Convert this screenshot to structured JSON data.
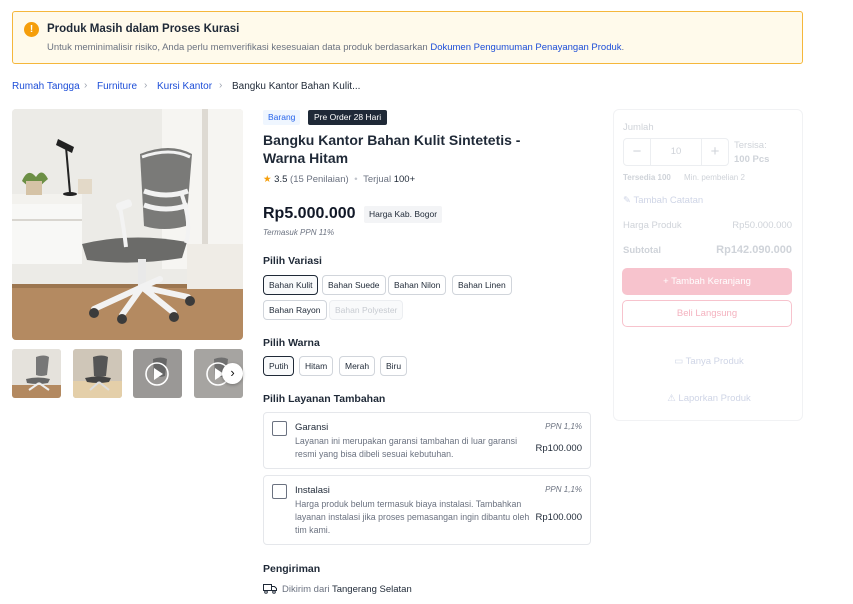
{
  "alert": {
    "icon": "warning-icon",
    "title": "Produk Masih dalam Proses Kurasi",
    "text": "Untuk meminimalisir risiko, Anda perlu memverifikasi kesesuaian data produk berdasarkan",
    "link": "Dokumen Pengumuman Penayangan Produk",
    "end": "."
  },
  "breadcrumb": {
    "items": [
      "Rumah Tangga",
      "Furniture",
      "Kursi Kantor"
    ],
    "current": "Bangku Kantor Bahan Kulit..."
  },
  "product": {
    "tag_type": "Barang",
    "tag_preorder": "Pre Order 28 Hari",
    "title": "Bangku Kantor Bahan Kulit Sintetetis - Warna Hitam",
    "rating_value": "3.5",
    "rating_count": "(15 Penilaian)",
    "sold_label": "Terjual",
    "sold_value": "100+",
    "price": "Rp5.000.000",
    "price_region": "Harga Kab. Bogor",
    "tax_note": "Termasuk PPN 11%"
  },
  "variant": {
    "label": "Pilih Variasi",
    "options": [
      "Bahan Kulit",
      "Bahan Suede",
      "Bahan Nilon",
      "Bahan Linen",
      "Bahan Rayon",
      "Bahan Polyester"
    ],
    "selected": "Bahan Kulit",
    "disabled": "Bahan Polyester"
  },
  "color": {
    "label": "Pilih Warna",
    "options": [
      "Putih",
      "Hitam",
      "Merah",
      "Biru"
    ],
    "selected": "Putih"
  },
  "addons": {
    "label": "Pilih Layanan Tambahan",
    "items": [
      {
        "name": "Garansi",
        "ppn": "PPN 1,1%",
        "desc": "Layanan ini merupakan garansi tambahan di luar garansi resmi yang bisa dibeli sesuai kebutuhan.",
        "price": "Rp100.000"
      },
      {
        "name": "Instalasi",
        "ppn": "PPN 1,1%",
        "desc": "Harga produk belum termasuk biaya instalasi. Tambahkan layanan instalasi jika proses pemasangan ingin dibantu oleh tim kami.",
        "price": "Rp100.000"
      }
    ]
  },
  "shipping": {
    "label": "Pengiriman",
    "prefix": "Dikirim dari",
    "city": "Tangerang Selatan",
    "icon": "truck-icon"
  },
  "purchase": {
    "qty_label": "Jumlah",
    "qty_value": "10",
    "stock_label": "Tersisa:",
    "stock_value": "100 Pcs",
    "available": "Tersedia 100",
    "min_purchase": "Min. pembelian 2",
    "note_link": "Tambah Catatan",
    "product_price_label": "Harga Produk",
    "product_price_value": "Rp50.000.000",
    "subtotal_label": "Subtotal",
    "subtotal_value": "Rp142.090.000",
    "add_cart": "Tambah Keranjang",
    "buy_now": "Beli Langsung",
    "ask": "Tanya Produk",
    "report": "Laporkan Produk"
  },
  "colors": {
    "accent_blue": "#1d4ed8",
    "warning": "#f59e0b",
    "primary_pink": "#f7c3cd"
  }
}
